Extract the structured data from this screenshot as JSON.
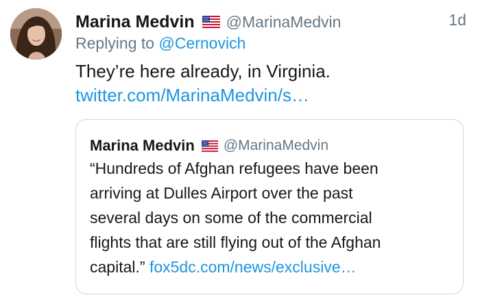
{
  "tweet": {
    "author": {
      "name": "Marina Medvin",
      "handle": "@MarinaMedvin",
      "flag_icon": "us-flag-icon",
      "avatar_icon": "profile-photo"
    },
    "timestamp": "1d",
    "replying_prefix": "Replying to",
    "replying_to": "@Cernovich",
    "text": "They’re here already, in Virginia.",
    "link": "twitter.com/MarinaMedvin/s…"
  },
  "quoted": {
    "author": {
      "name": "Marina Medvin",
      "handle": "@MarinaMedvin",
      "flag_icon": "us-flag-icon"
    },
    "lines": [
      "“Hundreds of Afghan refugees have been",
      "arriving at Dulles Airport over the past",
      "several days on some of the commercial",
      "flights that are still flying out of the Afghan",
      "capital.”"
    ],
    "link": "fox5dc.com/news/exclusive…"
  },
  "colors": {
    "text": "#14171a",
    "secondary": "#657786",
    "link": "#1b95e0",
    "border": "#ccd6dd"
  }
}
